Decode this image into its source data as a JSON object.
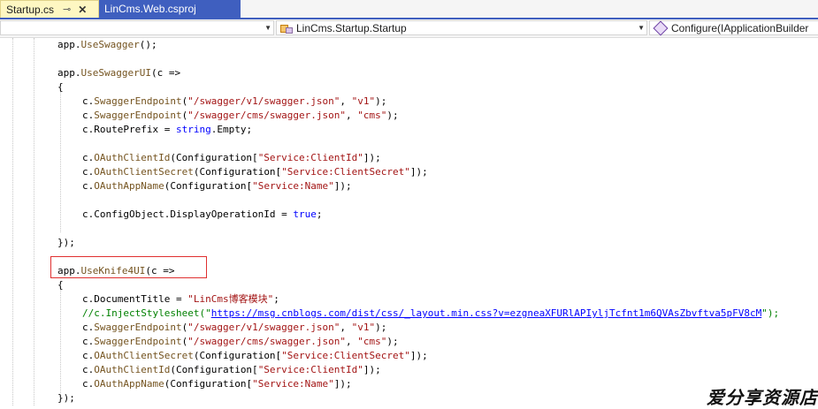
{
  "tabs": [
    {
      "label": "Startup.cs",
      "active": true,
      "pin_icon": "pin-icon",
      "close_icon": "close-icon"
    },
    {
      "label": "LinCms.Web.csproj",
      "active": false
    }
  ],
  "nav": {
    "project_selector": "",
    "type_selector": "LinCms.Startup.Startup",
    "member_selector": "Configure(IApplicationBuilder"
  },
  "code": {
    "l1": {
      "obj": "app.",
      "method": "UseSwagger",
      "rest": "();"
    },
    "l3": {
      "obj": "app.",
      "method": "UseSwaggerUI",
      "rest": "(c =>"
    },
    "l4": "{",
    "l5": {
      "obj": "c.",
      "method": "SwaggerEndpoint",
      "open": "(",
      "s1": "\"/swagger/v1/swagger.json\"",
      "sep": ", ",
      "s2": "\"v1\"",
      "close": ");"
    },
    "l6": {
      "obj": "c.",
      "method": "SwaggerEndpoint",
      "open": "(",
      "s1": "\"/swagger/cms/swagger.json\"",
      "sep": ", ",
      "s2": "\"cms\"",
      "close": ");"
    },
    "l7": {
      "pre": "c.RoutePrefix = ",
      "kw": "string",
      "post": ".Empty;"
    },
    "l9": {
      "obj": "c.",
      "method": "OAuthClientId",
      "open": "(Configuration[",
      "s1": "\"Service:ClientId\"",
      "close": "]);"
    },
    "l10": {
      "obj": "c.",
      "method": "OAuthClientSecret",
      "open": "(Configuration[",
      "s1": "\"Service:ClientSecret\"",
      "close": "]);"
    },
    "l11": {
      "obj": "c.",
      "method": "OAuthAppName",
      "open": "(Configuration[",
      "s1": "\"Service:Name\"",
      "close": "]);"
    },
    "l13": {
      "pre": "c.ConfigObject.DisplayOperationId = ",
      "kw": "true",
      "post": ";"
    },
    "l15": "});",
    "l17": {
      "obj": "app.",
      "method": "UseKnife4UI",
      "rest": "(c =>"
    },
    "l18": "{",
    "l19": {
      "pre": "c.DocumentTitle = ",
      "s1": "\"LinCms博客模块\"",
      "post": ";"
    },
    "l20": {
      "comment": "//c.InjectStylesheet(\"",
      "url": "https://msg.cnblogs.com/dist/css/_layout.min.css?v=ezgneaXFURlAPIyljTcfnt1m6QVAsZbvftva5pFV8cM",
      "tail": "\");"
    },
    "l21": {
      "obj": "c.",
      "method": "SwaggerEndpoint",
      "open": "(",
      "s1": "\"/swagger/v1/swagger.json\"",
      "sep": ", ",
      "s2": "\"v1\"",
      "close": ");"
    },
    "l22": {
      "obj": "c.",
      "method": "SwaggerEndpoint",
      "open": "(",
      "s1": "\"/swagger/cms/swagger.json\"",
      "sep": ", ",
      "s2": "\"cms\"",
      "close": ");"
    },
    "l23": {
      "obj": "c.",
      "method": "OAuthClientSecret",
      "open": "(Configuration[",
      "s1": "\"Service:ClientSecret\"",
      "close": "]);"
    },
    "l24": {
      "obj": "c.",
      "method": "OAuthClientId",
      "open": "(Configuration[",
      "s1": "\"Service:ClientId\"",
      "close": "]);"
    },
    "l25": {
      "obj": "c.",
      "method": "OAuthAppName",
      "open": "(Configuration[",
      "s1": "\"Service:Name\"",
      "close": "]);"
    },
    "l26": "});"
  },
  "watermark": "爱分享资源店",
  "colors": {
    "tab_active_bg": "#fef7c2",
    "tab_bar_accent": "#3f5fbf",
    "method": "#74531f",
    "string": "#a31515",
    "keyword": "#0000ff",
    "comment": "#008000",
    "highlight_box": "#e03030"
  }
}
